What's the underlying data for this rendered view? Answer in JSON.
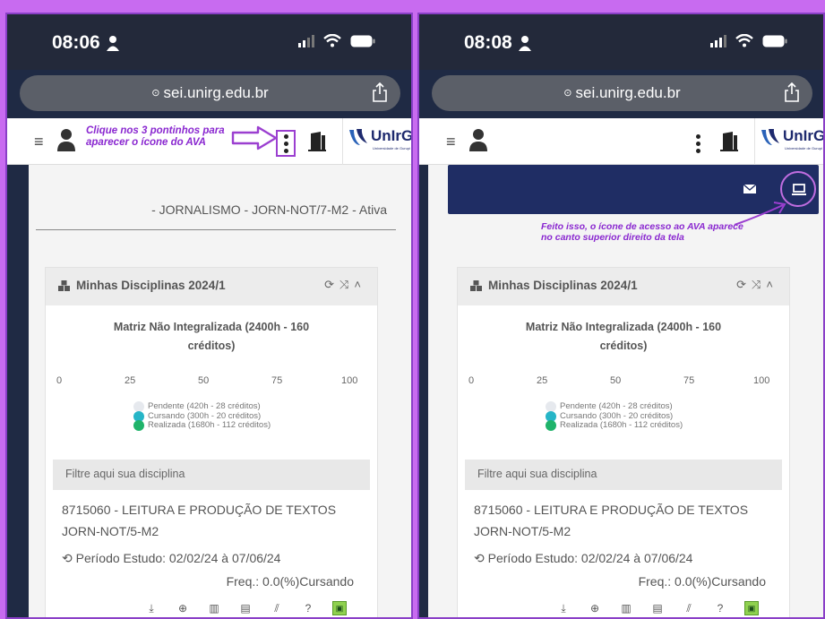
{
  "left": {
    "time": "08:06",
    "url": "sei.unirg.edu.br",
    "logo_name": "UnIrG",
    "logo_sub": "Universidade de Gurupi",
    "callout": "Clique nos 3 pontinhos para aparecer o ícone do AVA",
    "course_line": "- JORNALISMO - JORN-NOT/7-M2 - Ativa",
    "card_title": "Minhas Disciplinas 2024/1",
    "matrix_title": "Matriz Não Integralizada (2400h - 160 créditos)",
    "scale": [
      "0",
      "25",
      "50",
      "75",
      "100"
    ],
    "legend": [
      {
        "label": "Pendente (420h - 28 créditos)",
        "color": "#e6e9ee"
      },
      {
        "label": "Cursando (300h - 20 créditos)",
        "color": "#26b5c7"
      },
      {
        "label": "Realizada (1680h - 112 créditos)",
        "color": "#1fb36a"
      }
    ],
    "filter_placeholder": "Filtre aqui sua disciplina",
    "disc_line1": "8715060 - LEITURA E PRODUÇÃO DE TEXTOS",
    "disc_line2": "JORN-NOT/5-M2",
    "periodo": "Período Estudo: 02/02/24 à 07/06/24",
    "freq": "Freq.: 0.0(%)Cursando"
  },
  "right": {
    "time": "08:08",
    "url": "sei.unirg.edu.br",
    "logo_name": "UnIrG",
    "logo_sub": "Universidade de Gurupi",
    "callout": "Feito isso, o ícone de acesso ao AVA aparece no canto superior direito da tela",
    "card_title": "Minhas Disciplinas 2024/1",
    "matrix_title": "Matriz Não Integralizada (2400h - 160 créditos)",
    "scale": [
      "0",
      "25",
      "50",
      "75",
      "100"
    ],
    "legend": [
      {
        "label": "Pendente (420h - 28 créditos)",
        "color": "#e6e9ee"
      },
      {
        "label": "Cursando (300h - 20 créditos)",
        "color": "#26b5c7"
      },
      {
        "label": "Realizada (1680h - 112 créditos)",
        "color": "#1fb36a"
      }
    ],
    "filter_placeholder": "Filtre aqui sua disciplina",
    "disc_line1": "8715060 - LEITURA E PRODUÇÃO DE TEXTOS",
    "disc_line2": "JORN-NOT/5-M2",
    "periodo": "Período Estudo: 02/02/24 à 07/06/24",
    "freq": "Freq.: 0.0(%)Cursando"
  },
  "colors": {
    "background": "#c86bf0",
    "callout": "#8a28d0",
    "navy": "#1f2d64",
    "brand": "#1e2a6e"
  },
  "icons": {
    "card_actions": [
      "download-icon",
      "globe-icon",
      "book-icon",
      "document-icon",
      "rss-icon",
      "help-icon",
      "ava-board-icon"
    ]
  }
}
